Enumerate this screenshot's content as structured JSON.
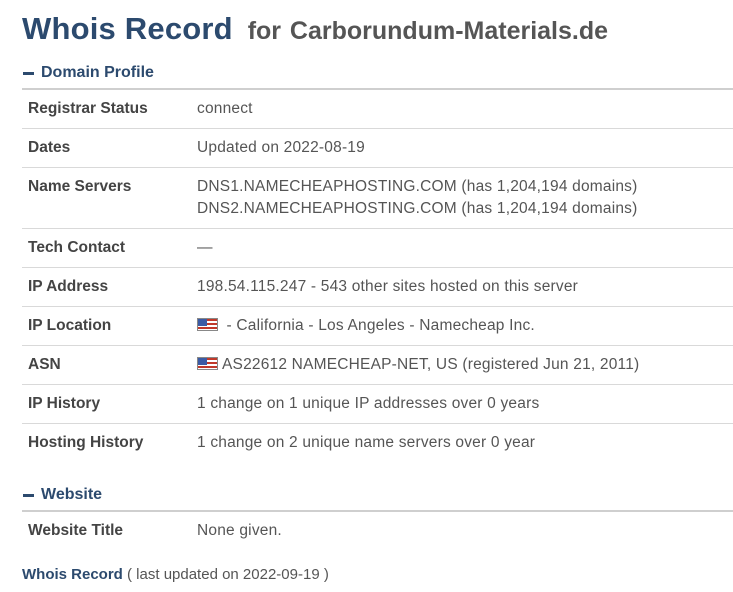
{
  "header": {
    "title_main": "Whois Record",
    "title_for": "for",
    "domain": "Carborundum-Materials.de"
  },
  "domain_profile": {
    "heading": "Domain Profile",
    "rows": [
      {
        "key": "Registrar Status",
        "value": "connect"
      },
      {
        "key": "Dates",
        "value": "Updated on 2022-08-19"
      },
      {
        "key": "Name Servers",
        "line1": "DNS1.NAMECHEAPHOSTING.COM (has 1,204,194 domains)",
        "line2": "DNS2.NAMECHEAPHOSTING.COM (has 1,204,194 domains)"
      },
      {
        "key": "Tech Contact",
        "value": "—"
      },
      {
        "key": "IP Address",
        "value": "198.54.115.247 - 543 other sites hosted on this server"
      },
      {
        "key": "IP Location",
        "value": " - California - Los Angeles - Namecheap Inc."
      },
      {
        "key": "ASN",
        "value": "AS22612 NAMECHEAP-NET, US (registered Jun 21, 2011)"
      },
      {
        "key": "IP History",
        "value": "1 change on 1 unique IP addresses over 0 years"
      },
      {
        "key": "Hosting History",
        "value": "1 change on 2 unique name servers over 0 year"
      }
    ]
  },
  "website": {
    "heading": "Website",
    "rows": [
      {
        "key": "Website Title",
        "value": "None given."
      }
    ]
  },
  "footer": {
    "link": "Whois Record",
    "note": "( last updated on 2022-09-19 )"
  },
  "icons": {
    "flag": "us-flag-icon",
    "collapse": "minus-icon"
  },
  "colors": {
    "accent": "#2c4a6e",
    "text": "#444444"
  }
}
